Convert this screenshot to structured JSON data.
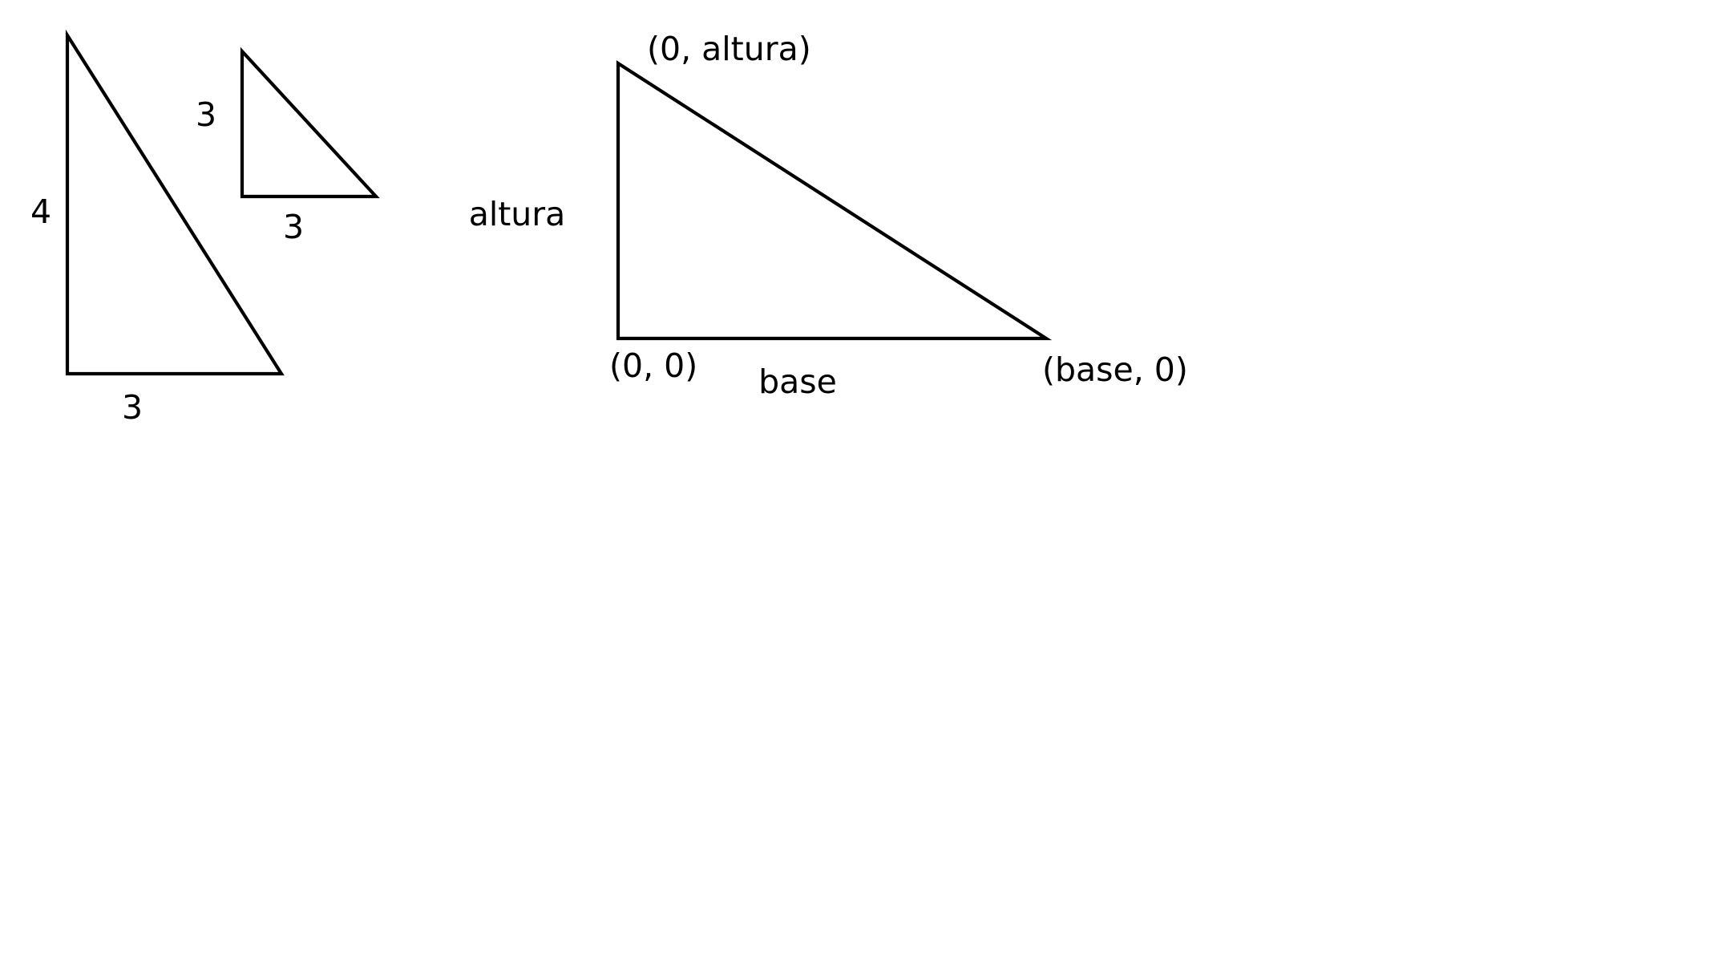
{
  "background_color": "#ffffff",
  "stroke_color": "#000000",
  "triangles": [
    {
      "name": "left-large-triangle",
      "labels": {
        "height": "4",
        "base": "3"
      }
    },
    {
      "name": "left-small-triangle",
      "labels": {
        "height": "3",
        "base": "3"
      }
    },
    {
      "name": "coordinate-triangle",
      "labels": {
        "height": "altura",
        "base": "base",
        "top_vertex": "(0, altura)",
        "origin_vertex": "(0, 0)",
        "right_vertex": "(base, 0)"
      }
    }
  ]
}
